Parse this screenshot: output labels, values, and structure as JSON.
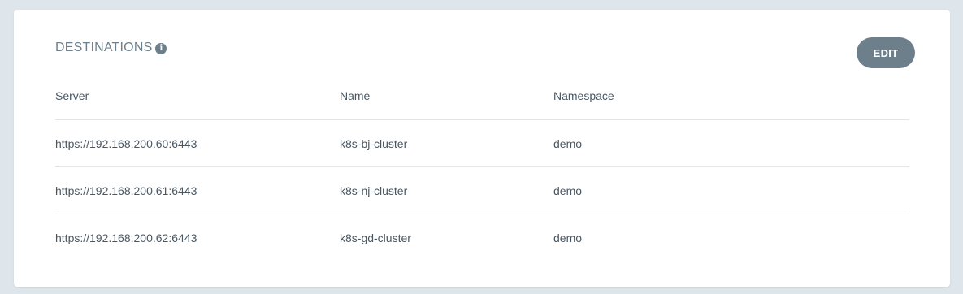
{
  "panel": {
    "title": "DESTINATIONS",
    "info_icon": "info-icon",
    "edit_label": "EDIT"
  },
  "table": {
    "headers": [
      "Server",
      "Name",
      "Namespace"
    ],
    "rows": [
      [
        "https://192.168.200.60:6443",
        "k8s-bj-cluster",
        "demo"
      ],
      [
        "https://192.168.200.61:6443",
        "k8s-nj-cluster",
        "demo"
      ],
      [
        "https://192.168.200.62:6443",
        "k8s-gd-cluster",
        "demo"
      ]
    ]
  },
  "colors": {
    "background": "#dee6eb",
    "button": "#6d7f8b",
    "text": "#495763"
  }
}
